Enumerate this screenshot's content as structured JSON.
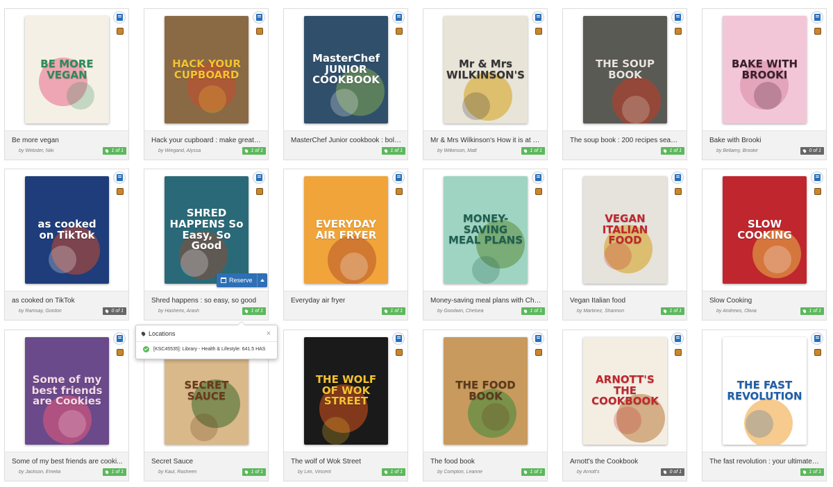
{
  "popover": {
    "title": "Locations",
    "close": "×",
    "entry": "[KSC45535]: Library - Health & Lifestyle: 641.5 HAS"
  },
  "reserve": {
    "label": "Reserve"
  },
  "items": [
    {
      "title": "Be more vegan",
      "author": "by Webster, Niki",
      "avail": "1 of 1",
      "available": true,
      "cover": {
        "text": "BE MORE VEGAN",
        "bg": "#f5f0e6",
        "fg": "#2e8b57",
        "accent": "#e86a8a"
      }
    },
    {
      "title": "Hack your cupboard : make great f...",
      "author": "by Wiegand, Alyssa",
      "avail": "1 of 1",
      "available": true,
      "cover": {
        "text": "HACK YOUR CUPBOARD",
        "bg": "#8a6a45",
        "fg": "#f5c331",
        "accent": "#c94a2c"
      }
    },
    {
      "title": "MasterChef Junior cookbook : bold...",
      "author": "",
      "avail": "1 of 1",
      "available": true,
      "cover": {
        "text": "MasterChef JUNIOR COOKBOOK",
        "bg": "#2f4f6b",
        "fg": "#ffffff",
        "accent": "#7fa650"
      }
    },
    {
      "title": "Mr & Mrs Wilkinson's How it is at h...",
      "author": "by Wilkinson, Matt",
      "avail": "1 of 1",
      "available": true,
      "cover": {
        "text": "Mr & Mrs WILKINSON'S",
        "bg": "#e9e4d8",
        "fg": "#333333",
        "accent": "#d4a017"
      }
    },
    {
      "title": "The soup book : 200 recipes seaso...",
      "author": "",
      "avail": "1 of 1",
      "available": true,
      "cover": {
        "text": "THE SOUP BOOK",
        "bg": "#5a5a55",
        "fg": "#e8e4dc",
        "accent": "#c23a22"
      }
    },
    {
      "title": "Bake with Brooki",
      "author": "by Bellamy, Brooke",
      "avail": "0 of 1",
      "available": false,
      "cover": {
        "text": "BAKE WITH BROOKI",
        "bg": "#f2c6d6",
        "fg": "#3a1f2a",
        "accent": "#d98aa6"
      }
    },
    {
      "title": "as cooked on TikTok",
      "author": "by Ramsay, Gordon",
      "avail": "0 of 1",
      "available": false,
      "cover": {
        "text": "as cooked on TikTok",
        "bg": "#1e3d7a",
        "fg": "#ffffff",
        "accent": "#c84a2a"
      }
    },
    {
      "title": "Shred happens : so easy, so good",
      "author": "by Hashemi, Arash",
      "avail": "1 of 1",
      "available": true,
      "cover": {
        "text": "SHRED HAPPENS So Easy, So Good",
        "bg": "#2a6a78",
        "fg": "#ffffff",
        "accent": "#8a4a36"
      }
    },
    {
      "title": "Everyday air fryer",
      "author": "",
      "avail": "1 of 1",
      "available": true,
      "cover": {
        "text": "EVERYDAY AIR FRYER",
        "bg": "#f0a43a",
        "fg": "#ffffff",
        "accent": "#b8532a"
      }
    },
    {
      "title": "Money-saving meal plans with Che...",
      "author": "by Goodwin, Chelsea",
      "avail": "1 of 1",
      "available": true,
      "cover": {
        "text": "MONEY-SAVING MEAL PLANS",
        "bg": "#9fd4c2",
        "fg": "#1f5f4f",
        "accent": "#5a8a3a"
      }
    },
    {
      "title": "Vegan Italian food",
      "author": "by Martinez, Shannon",
      "avail": "1 of 1",
      "available": true,
      "cover": {
        "text": "VEGAN ITALIAN FOOD",
        "bg": "#e6e2dc",
        "fg": "#c0262d",
        "accent": "#d4a017"
      }
    },
    {
      "title": "Slow Cooking",
      "author": "by Andrews, Olivia",
      "avail": "1 of 1",
      "available": true,
      "cover": {
        "text": "SLOW COOKING",
        "bg": "#c0262d",
        "fg": "#ffffff",
        "accent": "#e6b84a"
      }
    },
    {
      "title": "Some of my best friends are cooki...",
      "author": "by Jackson, Emelia",
      "avail": "1 of 1",
      "available": true,
      "cover": {
        "text": "Some of my best friends are Cookies",
        "bg": "#6a4a8a",
        "fg": "#f6d8e8",
        "accent": "#e85a7a"
      }
    },
    {
      "title": "Secret Sauce",
      "author": "by Kaul, Rasheen",
      "avail": "1 of 1",
      "available": true,
      "cover": {
        "text": "SECRET SAUCE",
        "bg": "#d9b98a",
        "fg": "#6a3a1a",
        "accent": "#3a6a2a"
      }
    },
    {
      "title": "The wolf of Wok Street",
      "author": "by Lim, Vincent",
      "avail": "1 of 1",
      "available": true,
      "cover": {
        "text": "THE WOLF OF WOK STREET",
        "bg": "#1a1a1a",
        "fg": "#f5c331",
        "accent": "#d9531e"
      }
    },
    {
      "title": "The food book",
      "author": "by Compton, Leanne",
      "avail": "1 of 1",
      "available": true,
      "cover": {
        "text": "THE FOOD BOOK",
        "bg": "#c99a5e",
        "fg": "#5a3a1a",
        "accent": "#3a8a3a"
      }
    },
    {
      "title": "Arnott's the Cookbook",
      "author": "by Arnott's",
      "avail": "0 of 1",
      "available": false,
      "cover": {
        "text": "ARNOTT'S THE COOKBOOK",
        "bg": "#f4ede2",
        "fg": "#c0262d",
        "accent": "#b87a3a"
      }
    },
    {
      "title": "The fast revolution : your ultimate i...",
      "author": "",
      "avail": "1 of 1",
      "available": true,
      "cover": {
        "text": "THE FAST REVOLUTION",
        "bg": "#ffffff",
        "fg": "#1f5fa8",
        "accent": "#f0a030"
      }
    }
  ]
}
